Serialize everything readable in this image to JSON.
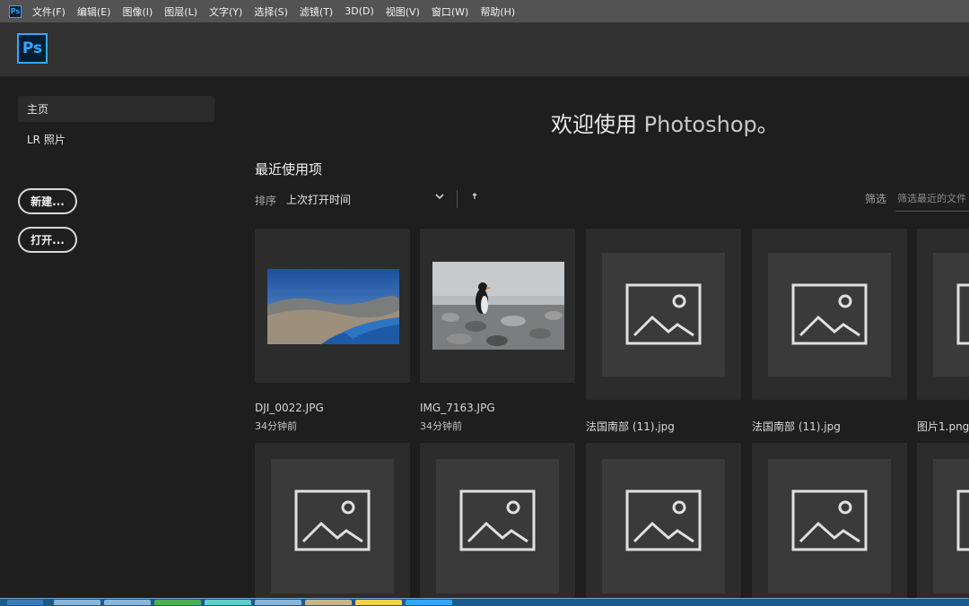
{
  "menubar": {
    "app_icon": "Ps",
    "items": [
      "文件(F)",
      "编辑(E)",
      "图像(I)",
      "图层(L)",
      "文字(Y)",
      "选择(S)",
      "滤镜(T)",
      "3D(D)",
      "视图(V)",
      "窗口(W)",
      "帮助(H)"
    ]
  },
  "logo": "Ps",
  "sidebar": {
    "nav": [
      "主页",
      "LR 照片"
    ],
    "new_button": "新建...",
    "open_button": "打开..."
  },
  "welcome": {
    "prefix": "欢迎使用 ",
    "brand": "Photoshop",
    "suffix": "。"
  },
  "recent": {
    "title": "最近使用项",
    "sort_label": "排序",
    "sort_value": "上次打开时间",
    "sort_chevron": "chevron-down-icon",
    "sort_direction": "arrow-up-icon",
    "filter_label": "筛选",
    "filter_placeholder": "筛选最近的文件"
  },
  "files_row1": [
    {
      "name": "DJI_0022.JPG",
      "time": "34分钟前",
      "thumb": "lake-landscape"
    },
    {
      "name": "IMG_7163.JPG",
      "time": "34分钟前",
      "thumb": "penguin-photo"
    },
    {
      "name": "法国南部 (11).jpg",
      "time": "",
      "thumb": "image-placeholder-icon"
    },
    {
      "name": "法国南部 (11).jpg",
      "time": "",
      "thumb": "image-placeholder-icon"
    },
    {
      "name": "图片1.png",
      "time": "",
      "thumb": "image-placeholder-icon"
    }
  ],
  "colors": {
    "accent": "#31a8ff",
    "background": "#1e1e1e",
    "menubar": "#535353"
  }
}
